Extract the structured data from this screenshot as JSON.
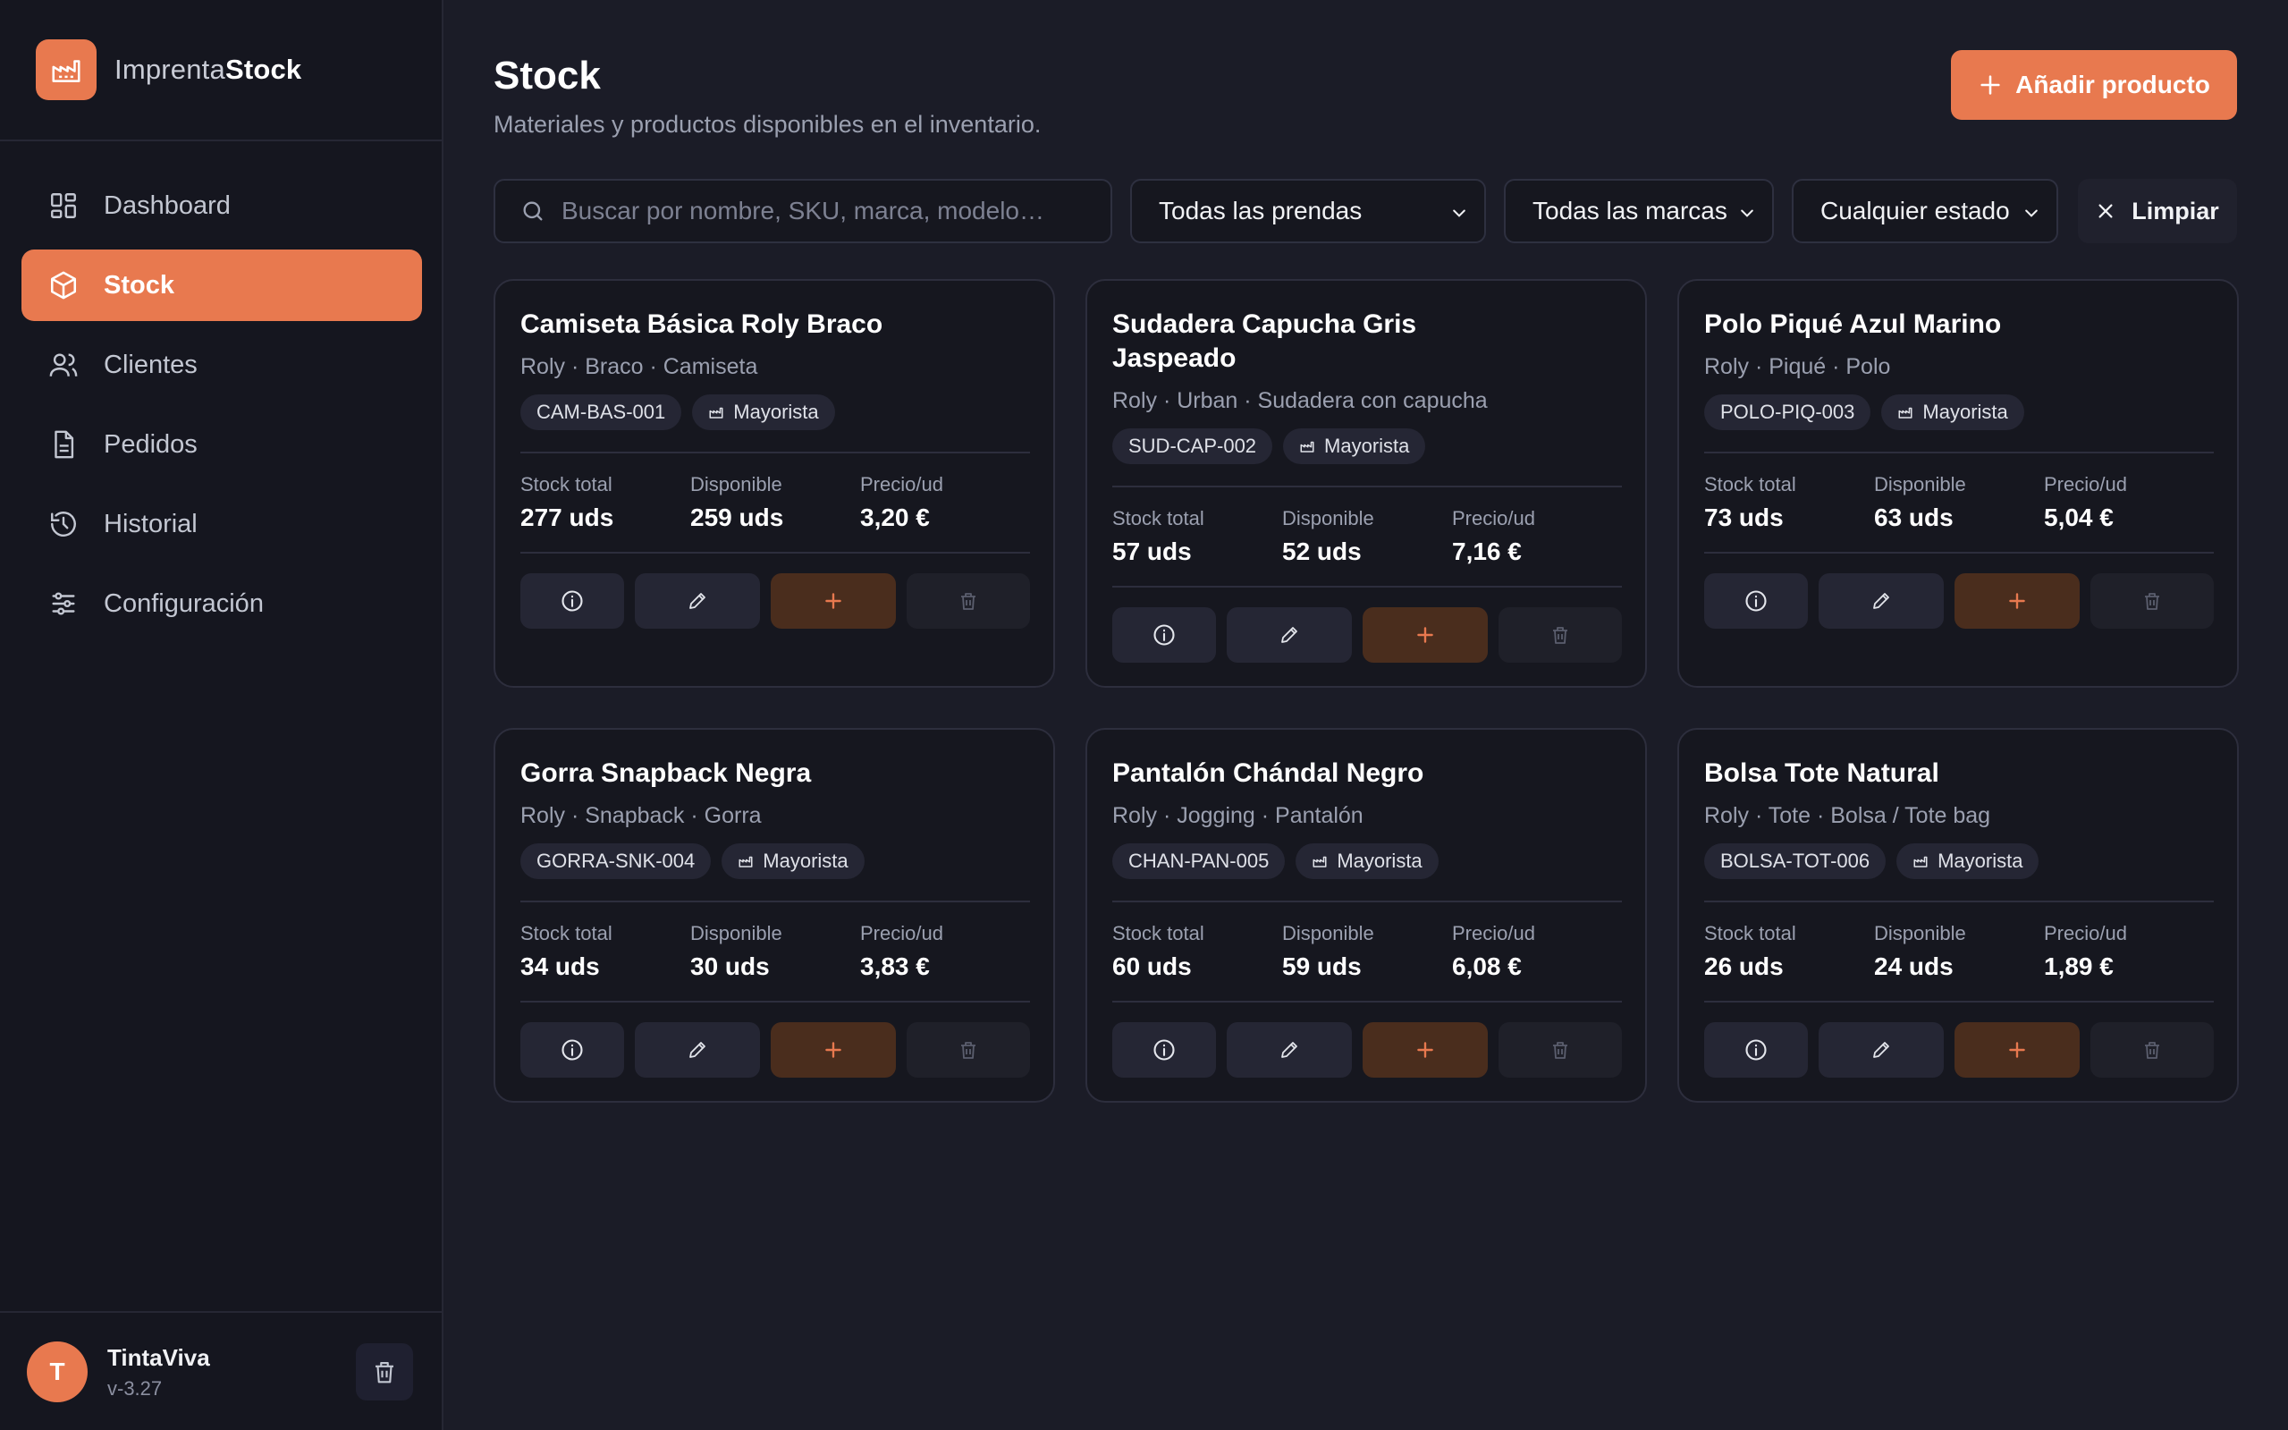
{
  "brand": {
    "name_light": "Imprenta",
    "name_bold": "Stock",
    "icon": "factory-icon"
  },
  "nav": [
    {
      "label": "Dashboard",
      "icon": "dashboard-icon",
      "active": false
    },
    {
      "label": "Stock",
      "icon": "box-icon",
      "active": true
    },
    {
      "label": "Clientes",
      "icon": "users-icon",
      "active": false
    },
    {
      "label": "Pedidos",
      "icon": "document-icon",
      "active": false
    },
    {
      "label": "Historial",
      "icon": "history-icon",
      "active": false
    },
    {
      "label": "Configuración",
      "icon": "sliders-icon",
      "active": false
    }
  ],
  "user": {
    "initial": "T",
    "name": "TintaViva",
    "version": "v-3.27"
  },
  "header": {
    "title": "Stock",
    "subtitle": "Materiales y productos disponibles en el inventario.",
    "add_label": "Añadir producto"
  },
  "filters": {
    "search_placeholder": "Buscar por nombre, SKU, marca, modelo…",
    "prendas": "Todas las prendas",
    "marcas": "Todas las marcas",
    "estado": "Cualquier estado",
    "clear_label": "Limpiar"
  },
  "stat_labels": {
    "total": "Stock total",
    "available": "Disponible",
    "price": "Precio/ud"
  },
  "products": [
    {
      "name": "Camiseta Básica Roly Braco",
      "meta": "Roly · Braco · Camiseta",
      "sku": "CAM-BAS-001",
      "tier": "Mayorista",
      "total": "277 uds",
      "available": "259 uds",
      "price": "3,20 €"
    },
    {
      "name": "Sudadera Capucha Gris Jaspeado",
      "meta": "Roly · Urban · Sudadera con capucha",
      "sku": "SUD-CAP-002",
      "tier": "Mayorista",
      "total": "57 uds",
      "available": "52 uds",
      "price": "7,16 €"
    },
    {
      "name": "Polo Piqué Azul Marino",
      "meta": "Roly · Piqué · Polo",
      "sku": "POLO-PIQ-003",
      "tier": "Mayorista",
      "total": "73 uds",
      "available": "63 uds",
      "price": "5,04 €"
    },
    {
      "name": "Gorra Snapback Negra",
      "meta": "Roly · Snapback · Gorra",
      "sku": "GORRA-SNK-004",
      "tier": "Mayorista",
      "total": "34 uds",
      "available": "30 uds",
      "price": "3,83 €"
    },
    {
      "name": "Pantalón Chándal Negro",
      "meta": "Roly · Jogging · Pantalón",
      "sku": "CHAN-PAN-005",
      "tier": "Mayorista",
      "total": "60 uds",
      "available": "59 uds",
      "price": "6,08 €"
    },
    {
      "name": "Bolsa Tote Natural",
      "meta": "Roly · Tote · Bolsa / Tote bag",
      "sku": "BOLSA-TOT-006",
      "tier": "Mayorista",
      "total": "26 uds",
      "available": "24 uds",
      "price": "1,89 €"
    }
  ],
  "colors": {
    "accent": "#e8794f",
    "background": "#1b1c27",
    "sidebar": "#15161f",
    "card": "#16171f"
  }
}
